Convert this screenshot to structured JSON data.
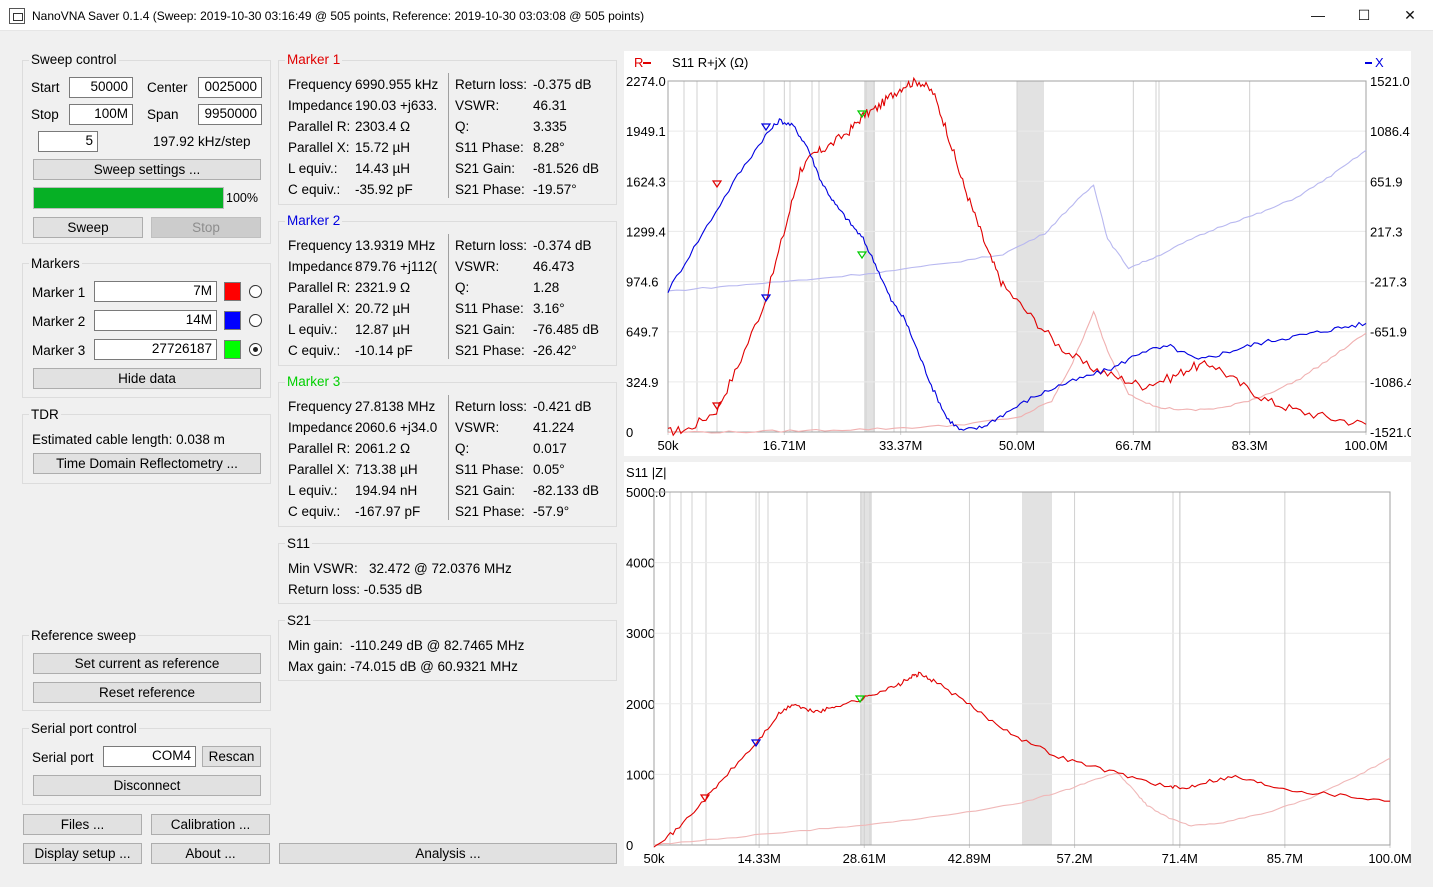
{
  "window": {
    "title": "NanoVNA Saver 0.1.4 (Sweep: 2019-10-30 03:16:49 @ 505 points, Reference: 2019-10-30 03:03:08 @ 505 points)",
    "minimize": "—",
    "maximize": "☐",
    "close": "✕"
  },
  "sweep": {
    "title": "Sweep control",
    "start_label": "Start",
    "start": "50000",
    "center_label": "Center",
    "center": "0025000",
    "stop_label": "Stop",
    "stop": "100M",
    "span_label": "Span",
    "span": "9950000",
    "segments": "5",
    "step": "197.92 kHz/step",
    "settings_btn": "Sweep settings ...",
    "progress": 100,
    "progress_text": "100%",
    "sweep_btn": "Sweep",
    "stop_btn": "Stop"
  },
  "markers": {
    "title": "Markers",
    "items": [
      {
        "label": "Marker 1",
        "value": "7M",
        "color": "#ff0000",
        "selected": false
      },
      {
        "label": "Marker 2",
        "value": "14M",
        "color": "#0000ff",
        "selected": false
      },
      {
        "label": "Marker 3",
        "value": "27726187",
        "color": "#00ff00",
        "selected": true
      }
    ],
    "hide_btn": "Hide data"
  },
  "tdr": {
    "title": "TDR",
    "cable": "Estimated cable length: 0.038 m",
    "btn": "Time Domain Reflectometry ..."
  },
  "reference": {
    "title": "Reference sweep",
    "set_btn": "Set current as reference",
    "reset_btn": "Reset reference"
  },
  "serial": {
    "title": "Serial port control",
    "port_label": "Serial port",
    "port": "COM4",
    "rescan_btn": "Rescan",
    "disconnect_btn": "Disconnect"
  },
  "bottom": {
    "files": "Files ...",
    "calibration": "Calibration ...",
    "display": "Display setup ...",
    "about": "About ...",
    "analysis": "Analysis ..."
  },
  "marker_data": [
    {
      "title": "Marker 1",
      "color": "#e00000",
      "left": [
        [
          "Frequency:",
          "6990.955 kHz"
        ],
        [
          "Impedance:",
          "190.03 +j633."
        ],
        [
          "Parallel R:",
          "2303.4 Ω"
        ],
        [
          "Parallel X:",
          "15.72 µH"
        ],
        [
          "L equiv.:",
          "14.43 µH"
        ],
        [
          "C equiv.:",
          "-35.92 pF"
        ]
      ],
      "right": [
        [
          "Return loss:",
          "-0.375 dB"
        ],
        [
          "VSWR:",
          "46.31"
        ],
        [
          "Q:",
          "3.335"
        ],
        [
          "S11 Phase:",
          "8.28°"
        ],
        [
          "S21 Gain:",
          "-81.526 dB"
        ],
        [
          "S21 Phase:",
          "-19.57°"
        ]
      ]
    },
    {
      "title": "Marker 2",
      "color": "#0000e0",
      "left": [
        [
          "Frequency:",
          "13.9319 MHz"
        ],
        [
          "Impedance:",
          "879.76 +j112("
        ],
        [
          "Parallel R:",
          "2321.9 Ω"
        ],
        [
          "Parallel X:",
          "20.72 µH"
        ],
        [
          "L equiv.:",
          "12.87 µH"
        ],
        [
          "C equiv.:",
          "-10.14 pF"
        ]
      ],
      "right": [
        [
          "Return loss:",
          "-0.374 dB"
        ],
        [
          "VSWR:",
          "46.473"
        ],
        [
          "Q:",
          "1.28"
        ],
        [
          "S11 Phase:",
          "3.16°"
        ],
        [
          "S21 Gain:",
          "-76.485 dB"
        ],
        [
          "S21 Phase:",
          "-26.42°"
        ]
      ]
    },
    {
      "title": "Marker 3",
      "color": "#00d000",
      "left": [
        [
          "Frequency:",
          "27.8138 MHz"
        ],
        [
          "Impedance:",
          "2060.6 +j34.0"
        ],
        [
          "Parallel R:",
          "2061.2 Ω"
        ],
        [
          "Parallel X:",
          "713.38 µH"
        ],
        [
          "L equiv.:",
          "194.94 nH"
        ],
        [
          "C equiv.:",
          "-167.97 pF"
        ]
      ],
      "right": [
        [
          "Return loss:",
          "-0.421 dB"
        ],
        [
          "VSWR:",
          "41.224"
        ],
        [
          "Q:",
          "0.017"
        ],
        [
          "S11 Phase:",
          "0.05°"
        ],
        [
          "S21 Gain:",
          "-82.133 dB"
        ],
        [
          "S21 Phase:",
          "-57.9°"
        ]
      ]
    }
  ],
  "s11_summary": {
    "title": "S11",
    "min_vswr": "Min VSWR:   32.472 @ 72.0376 MHz",
    "return_loss": "Return loss: -0.535 dB"
  },
  "s21_summary": {
    "title": "S21",
    "min_gain": "Min gain:  -110.249 dB @ 82.7465 MHz",
    "max_gain": "Max gain: -74.015 dB @ 60.9321 MHz"
  },
  "chart_data": [
    {
      "type": "line",
      "title": "S11  R+jX (Ω)",
      "legend_r": "R",
      "legend_x": "X",
      "x_ticks": [
        "50k",
        "16.71M",
        "33.37M",
        "50.0M",
        "66.7M",
        "83.3M",
        "100.0M"
      ],
      "y_ticks_left": [
        "2274.0",
        "1949.1",
        "1624.3",
        "1299.4",
        "974.6",
        "649.7",
        "324.9",
        "0"
      ],
      "y_ticks_right": [
        "1521.0",
        "1086.4",
        "651.9",
        "217.3",
        "-217.3",
        "-651.9",
        "-1086.4",
        "-1521.0"
      ],
      "xlim": [
        0.05,
        100
      ],
      "ylim_left": [
        0,
        2274
      ],
      "ylim_right": [
        -1521,
        1521
      ],
      "series": [
        {
          "color": "#e00000",
          "axis": "left",
          "x": [
            0.05,
            3,
            7,
            10,
            14,
            17,
            19,
            21,
            23,
            26,
            28,
            30,
            32,
            34,
            36,
            38,
            40,
            42,
            44,
            46,
            48,
            52,
            56,
            60,
            64,
            68,
            72,
            75,
            78,
            82,
            86,
            90,
            95,
            100
          ],
          "y": [
            0,
            20,
            140,
            420,
            850,
            1350,
            1700,
            1800,
            1850,
            1950,
            2050,
            2100,
            2180,
            2250,
            2274,
            2200,
            1950,
            1650,
            1400,
            1150,
            950,
            750,
            560,
            430,
            360,
            300,
            350,
            420,
            440,
            310,
            200,
            140,
            90,
            50
          ]
        },
        {
          "color": "#0000e0",
          "axis": "right",
          "x": [
            0.05,
            5,
            10,
            14,
            16,
            18,
            20,
            22,
            24,
            26,
            28,
            30,
            32,
            34,
            36,
            38,
            40,
            42,
            45,
            48,
            52,
            56,
            60,
            64,
            68,
            72,
            76,
            80,
            84,
            88,
            92,
            96,
            100
          ],
          "y": [
            -300,
            200,
            700,
            1050,
            1180,
            1130,
            950,
            650,
            450,
            300,
            150,
            -100,
            -380,
            -550,
            -850,
            -1150,
            -1400,
            -1510,
            -1480,
            -1370,
            -1230,
            -1120,
            -1040,
            -960,
            -820,
            -780,
            -900,
            -830,
            -760,
            -710,
            -670,
            -620,
            -580
          ]
        },
        {
          "color": "#f0b0b0",
          "axis": "left",
          "x": [
            0.05,
            10,
            20,
            30,
            40,
            50,
            55,
            58,
            61,
            63,
            66,
            70,
            75,
            80,
            85,
            90,
            95,
            100
          ],
          "y": [
            0,
            0,
            10,
            20,
            40,
            90,
            200,
            450,
            780,
            520,
            250,
            160,
            140,
            160,
            230,
            330,
            480,
            640
          ]
        },
        {
          "color": "#b8b8f0",
          "axis": "right",
          "x": [
            0.05,
            10,
            20,
            30,
            40,
            48,
            54,
            58,
            61,
            63,
            66,
            70,
            75,
            80,
            85,
            90,
            95,
            100
          ],
          "y": [
            -300,
            -250,
            -200,
            -140,
            -60,
            20,
            200,
            450,
            620,
            150,
            -100,
            0,
            150,
            280,
            380,
            510,
            700,
            920
          ]
        }
      ]
    },
    {
      "type": "line",
      "title": "S11  |Z|",
      "x_ticks": [
        "50k",
        "14.33M",
        "28.61M",
        "42.89M",
        "57.2M",
        "71.4M",
        "85.7M",
        "100.0M"
      ],
      "y_ticks": [
        "5000.0",
        "4000",
        "3000",
        "2000",
        "1000",
        "0"
      ],
      "xlim": [
        0.05,
        100
      ],
      "ylim": [
        0,
        5000
      ],
      "series": [
        {
          "color": "#e00000",
          "x": [
            0.05,
            3,
            7,
            10,
            14,
            17,
            19,
            21,
            23,
            25,
            28,
            30,
            33,
            35,
            36,
            38,
            42,
            46,
            50,
            55,
            60,
            65,
            70,
            72,
            75,
            79,
            83,
            88,
            94,
            100
          ],
          "y": [
            0,
            200,
            650,
            1000,
            1450,
            1850,
            2000,
            1900,
            1900,
            1980,
            2050,
            2150,
            2250,
            2380,
            2420,
            2330,
            2050,
            1750,
            1500,
            1250,
            1100,
            960,
            820,
            800,
            900,
            970,
            860,
            760,
            700,
            620
          ]
        },
        {
          "color": "#f0b8b8",
          "x": [
            0.05,
            10,
            20,
            30,
            40,
            50,
            56,
            60,
            63,
            65,
            67,
            70,
            73,
            78,
            84,
            90,
            96,
            100
          ],
          "y": [
            0,
            100,
            200,
            300,
            420,
            600,
            780,
            930,
            1020,
            800,
            560,
            380,
            270,
            330,
            480,
            700,
            1000,
            1230
          ]
        }
      ]
    }
  ]
}
